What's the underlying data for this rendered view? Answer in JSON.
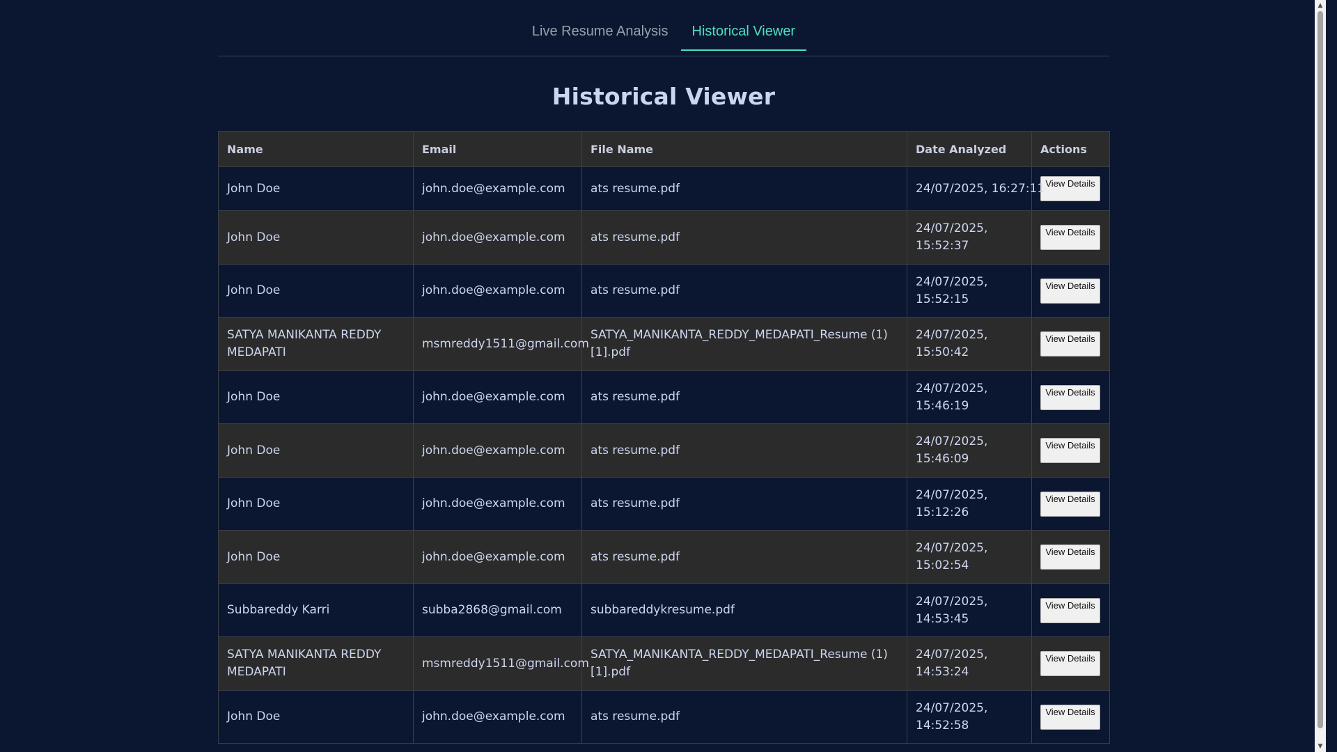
{
  "tabs": [
    {
      "label": "Live Resume Analysis",
      "active": false
    },
    {
      "label": "Historical Viewer",
      "active": true
    }
  ],
  "page_title": "Historical Viewer",
  "table": {
    "headers": [
      "Name",
      "Email",
      "File Name",
      "Date Analyzed",
      "Actions"
    ],
    "action_label": "View Details",
    "rows": [
      {
        "name": "John Doe",
        "email": "john.doe@example.com",
        "file": "ats resume.pdf",
        "date": "24/07/2025, 16:27:11"
      },
      {
        "name": "John Doe",
        "email": "john.doe@example.com",
        "file": "ats resume.pdf",
        "date": "24/07/2025, 15:52:37"
      },
      {
        "name": "John Doe",
        "email": "john.doe@example.com",
        "file": "ats resume.pdf",
        "date": "24/07/2025, 15:52:15"
      },
      {
        "name": "SATYA MANIKANTA REDDY MEDAPATI",
        "email": "msmreddy1511@gmail.com",
        "file": "SATYA_MANIKANTA_REDDY_MEDAPATI_Resume (1) [1].pdf",
        "date": "24/07/2025, 15:50:42"
      },
      {
        "name": "John Doe",
        "email": "john.doe@example.com",
        "file": "ats resume.pdf",
        "date": "24/07/2025, 15:46:19"
      },
      {
        "name": "John Doe",
        "email": "john.doe@example.com",
        "file": "ats resume.pdf",
        "date": "24/07/2025, 15:46:09"
      },
      {
        "name": "John Doe",
        "email": "john.doe@example.com",
        "file": "ats resume.pdf",
        "date": "24/07/2025, 15:12:26"
      },
      {
        "name": "John Doe",
        "email": "john.doe@example.com",
        "file": "ats resume.pdf",
        "date": "24/07/2025, 15:02:54"
      },
      {
        "name": "Subbareddy Karri",
        "email": "subba2868@gmail.com",
        "file": "subbareddykresume.pdf",
        "date": "24/07/2025, 14:53:45"
      },
      {
        "name": "SATYA MANIKANTA REDDY MEDAPATI",
        "email": "msmreddy1511@gmail.com",
        "file": "SATYA_MANIKANTA_REDDY_MEDAPATI_Resume (1) [1].pdf",
        "date": "24/07/2025, 14:53:24"
      },
      {
        "name": "John Doe",
        "email": "john.doe@example.com",
        "file": "ats resume.pdf",
        "date": "24/07/2025, 14:52:58"
      }
    ]
  },
  "colors": {
    "background": "#0b1730",
    "row_alt": "#2b2b2b",
    "accent": "#4ee0c3"
  },
  "icons": {
    "scroll_up": "triangle-up-icon",
    "scroll_down": "triangle-down-icon"
  }
}
